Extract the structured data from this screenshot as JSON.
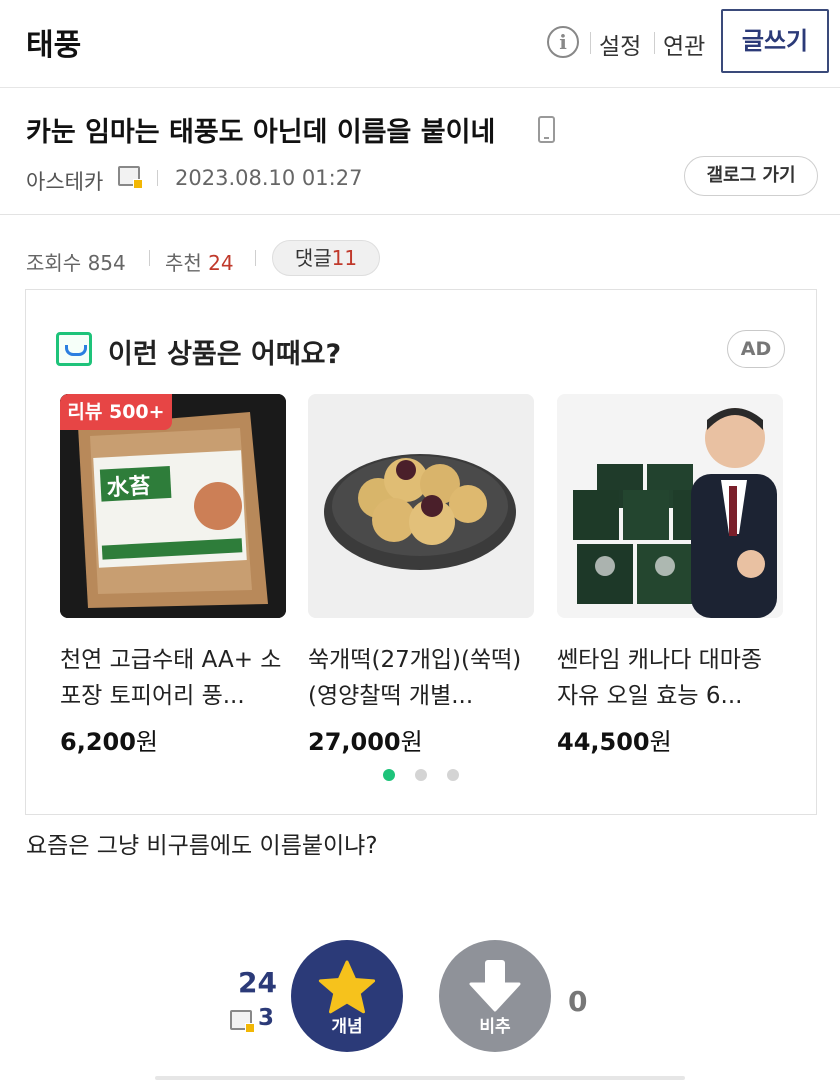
{
  "board": {
    "title": "태풍"
  },
  "topnav": {
    "settings": "설정",
    "related": "연관",
    "write": "글쓰기"
  },
  "post": {
    "title": "카눈 임마는 태풍도 아닌데 이름을 붙이네",
    "author": "아스테카",
    "date": "2023.08.10 01:27",
    "gallery_button": "갤로그 가기",
    "body": "요즘은 그냥 비구름에도 이름붙이냐?"
  },
  "stats": {
    "views_label": "조회수",
    "views": "854",
    "recommend_label": "추천",
    "recommend": "24",
    "comment_label": "댓글",
    "comments": "11"
  },
  "ad": {
    "heading": "이런 상품은 어때요?",
    "badge": "AD",
    "products": [
      {
        "badge": "리뷰 500+",
        "name": "천연 고급수태 AA+ 소포장 토피어리 풍...",
        "price": "6,200",
        "unit": "원"
      },
      {
        "name": "쑥개떡(27개입)(쑥떡)(영양찰떡 개별...",
        "price": "27,000",
        "unit": "원"
      },
      {
        "name": "쎈타임 캐나다 대마종자유 오일 효능 6...",
        "price": "44,500",
        "unit": "원"
      }
    ],
    "active_dot": 0
  },
  "vote": {
    "up_count": "24",
    "fixed_count": "3",
    "up_label": "개념",
    "down_label": "비추",
    "down_count": "0"
  },
  "colors": {
    "accent": "#2b3a78",
    "red": "#c0392b",
    "dot_active": "#1ec37a"
  }
}
